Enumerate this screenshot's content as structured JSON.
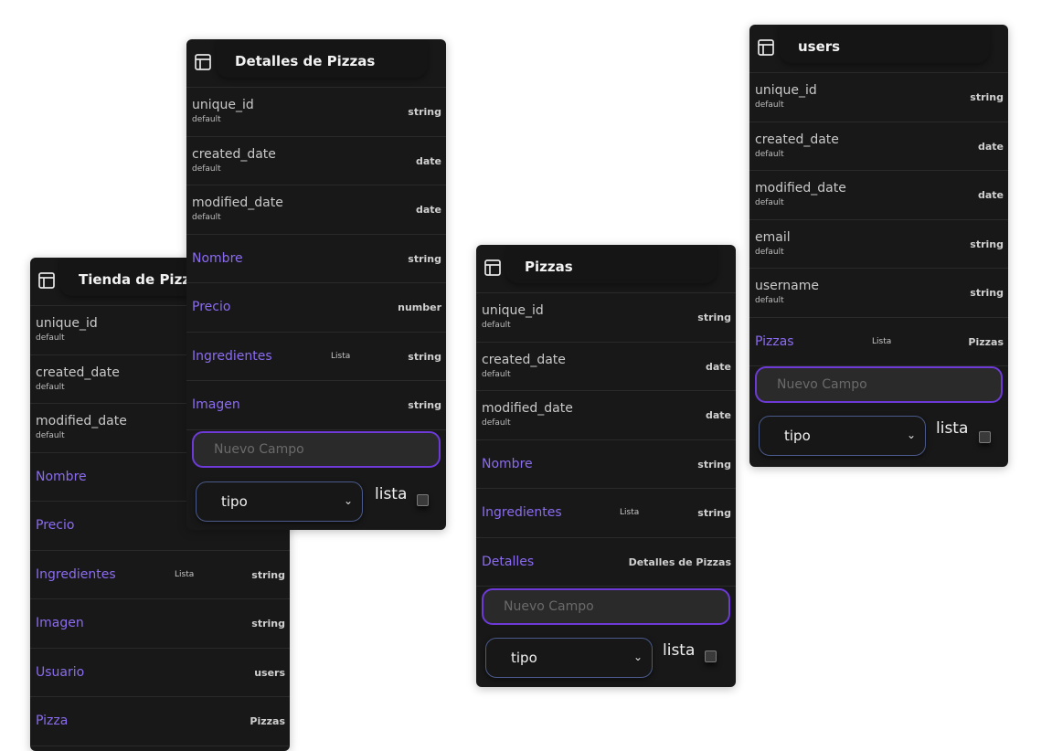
{
  "tienda": {
    "title": "Tienda de Pizza",
    "fields": [
      {
        "name": "unique_id",
        "sub": "default",
        "type": ""
      },
      {
        "name": "created_date",
        "sub": "default",
        "type": ""
      },
      {
        "name": "modified_date",
        "sub": "default",
        "type": ""
      },
      {
        "name": "Nombre",
        "type": ""
      },
      {
        "name": "Precio",
        "type": ""
      },
      {
        "name": "Ingredientes",
        "flag": "Lista",
        "type": "string"
      },
      {
        "name": "Imagen",
        "type": "string"
      },
      {
        "name": "Usuario",
        "type": "users"
      },
      {
        "name": "Pizza",
        "type": "Pizzas"
      }
    ]
  },
  "detalles": {
    "title": "Detalles de Pizzas",
    "fields": [
      {
        "name": "unique_id",
        "sub": "default",
        "type": "string"
      },
      {
        "name": "created_date",
        "sub": "default",
        "type": "date"
      },
      {
        "name": "modified_date",
        "sub": "default",
        "type": "date"
      },
      {
        "name": "Nombre",
        "type": "string"
      },
      {
        "name": "Precio",
        "type": "number"
      },
      {
        "name": "Ingredientes",
        "flag": "Lista",
        "type": "string"
      },
      {
        "name": "Imagen",
        "type": "string"
      }
    ],
    "new_field_placeholder": "Nuevo Campo",
    "type_select_value": "tipo",
    "lista_label": "lista"
  },
  "pizzas": {
    "title": "Pizzas",
    "fields": [
      {
        "name": "unique_id",
        "sub": "default",
        "type": "string"
      },
      {
        "name": "created_date",
        "sub": "default",
        "type": "date"
      },
      {
        "name": "modified_date",
        "sub": "default",
        "type": "date"
      },
      {
        "name": "Nombre",
        "type": "string"
      },
      {
        "name": "Ingredientes",
        "flag": "Lista",
        "type": "string"
      },
      {
        "name": "Detalles",
        "type": "Detalles de Pizzas"
      }
    ],
    "new_field_placeholder": "Nuevo Campo",
    "type_select_value": "tipo",
    "lista_label": "lista"
  },
  "users": {
    "title": "users",
    "fields": [
      {
        "name": "unique_id",
        "sub": "default",
        "type": "string"
      },
      {
        "name": "created_date",
        "sub": "default",
        "type": "date"
      },
      {
        "name": "modified_date",
        "sub": "default",
        "type": "date"
      },
      {
        "name": "email",
        "sub": "default",
        "type": "string"
      },
      {
        "name": "username",
        "sub": "default",
        "type": "string"
      },
      {
        "name": "Pizzas",
        "flag": "Lista",
        "type": "Pizzas"
      }
    ],
    "new_field_placeholder": "Nuevo Campo",
    "type_select_value": "tipo",
    "lista_label": "lista"
  },
  "colors": {
    "card_bg": "#181818",
    "custom_field": "#8b6cf0",
    "accent_border": "#6d3ad8"
  },
  "icons": {
    "table": "table-icon",
    "chevron": "chevron-down-icon"
  }
}
